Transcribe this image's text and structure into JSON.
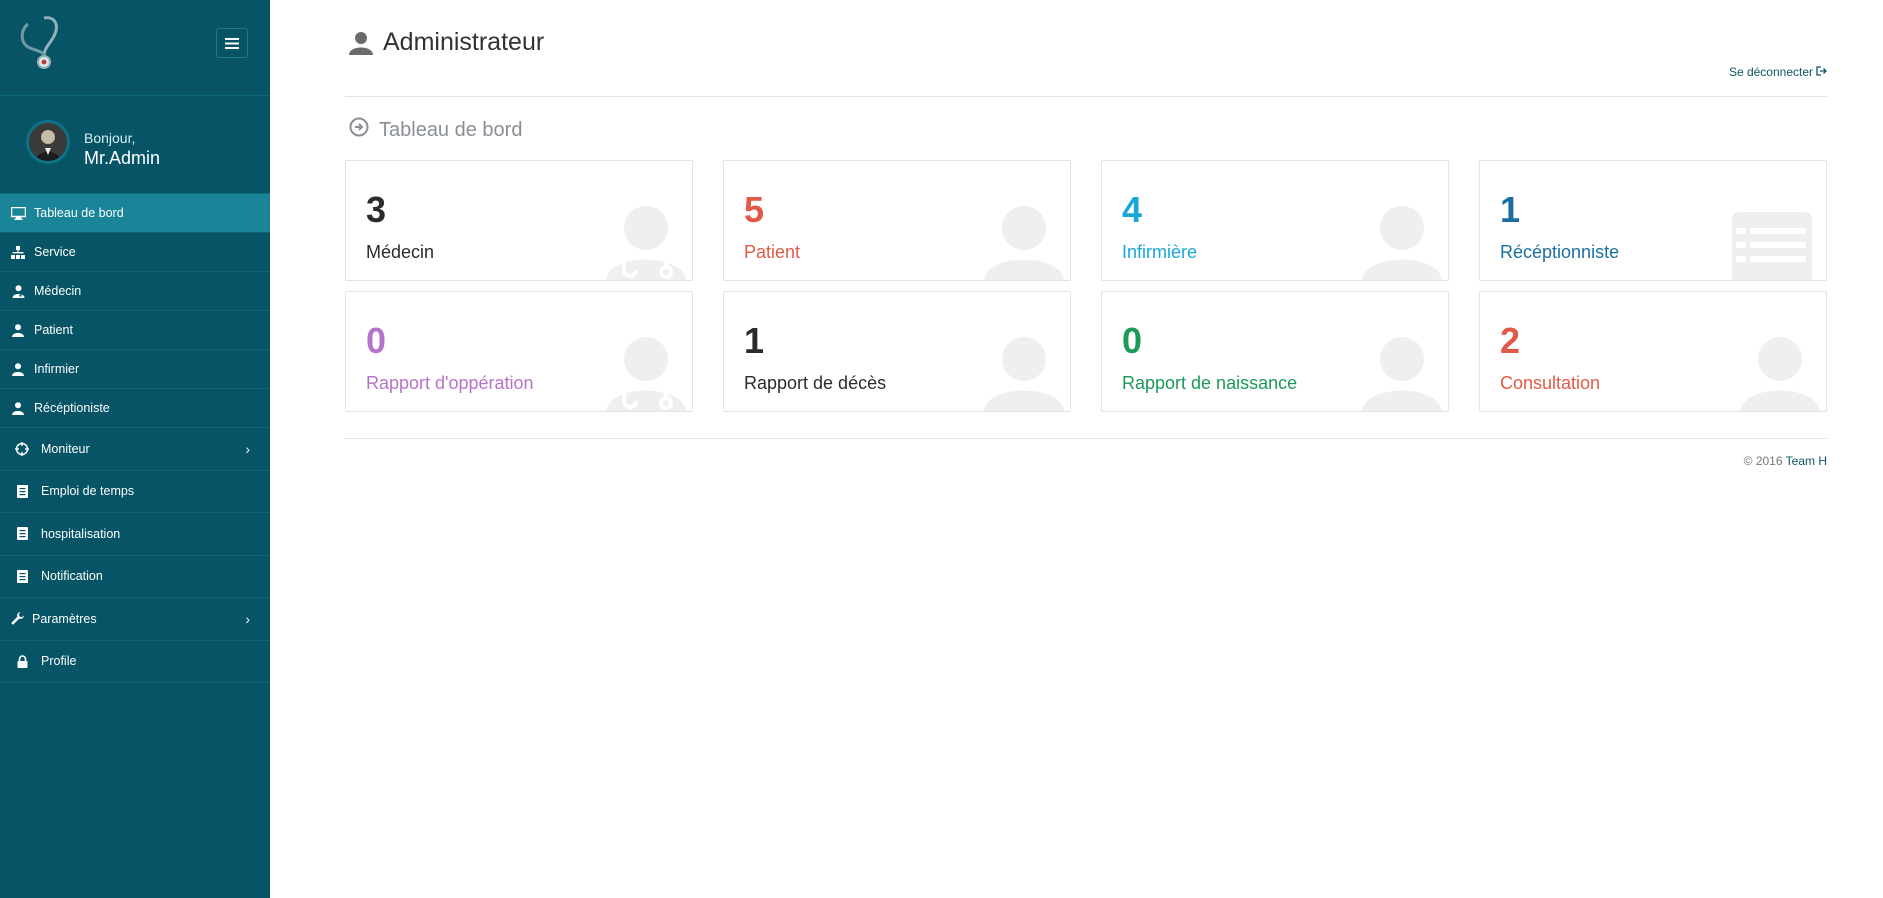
{
  "sidebar": {
    "greeting": "Bonjour,",
    "user_name": "Mr.Admin",
    "items": [
      {
        "label": "Tableau de bord",
        "icon": "monitor-icon",
        "active": true
      },
      {
        "label": "Service",
        "icon": "sitemap-icon"
      },
      {
        "label": "Médecin",
        "icon": "user-md-icon"
      },
      {
        "label": "Patient",
        "icon": "user-icon"
      },
      {
        "label": "Infirmier",
        "icon": "user-icon"
      },
      {
        "label": "Récéptioniste",
        "icon": "user-icon"
      },
      {
        "label": "Moniteur",
        "icon": "crosshair-icon",
        "has_submenu": true
      },
      {
        "label": "Emploi de temps",
        "icon": "document-icon"
      },
      {
        "label": "hospitalisation",
        "icon": "document-icon"
      },
      {
        "label": "Notification",
        "icon": "document-icon"
      },
      {
        "label": "Paramètres",
        "icon": "wrench-icon",
        "has_submenu": true
      },
      {
        "label": "Profile",
        "icon": "lock-icon"
      }
    ]
  },
  "header": {
    "title": "Administrateur",
    "logout_label": "Se déconnecter"
  },
  "main": {
    "section_title": "Tableau de bord",
    "cards": [
      {
        "value": "3",
        "label": "Médecin",
        "color": "#2b2b2b",
        "icon": "doctor-icon"
      },
      {
        "value": "5",
        "label": "Patient",
        "color": "#e05a47",
        "icon": "person-icon"
      },
      {
        "value": "4",
        "label": "Infirmière",
        "color": "#19a8d6",
        "icon": "person-icon"
      },
      {
        "value": "1",
        "label": "Récéptionniste",
        "color": "#1a6fa0",
        "icon": "list-icon"
      },
      {
        "value": "0",
        "label": "Rapport d'oppération",
        "color": "#b673c9",
        "icon": "doctor-icon"
      },
      {
        "value": "1",
        "label": "Rapport de décès",
        "color": "#2b2b2b",
        "icon": "person-icon"
      },
      {
        "value": "0",
        "label": "Rapport de naissance",
        "color": "#1b9a5a",
        "icon": "person-icon"
      },
      {
        "value": "2",
        "label": "Consultation",
        "color": "#e05a47",
        "icon": "person-icon"
      }
    ]
  },
  "footer": {
    "copyright": "© 2016",
    "team": "Team H"
  },
  "colors": {
    "sidebar_bg": "#065465",
    "sidebar_active": "#1a8499"
  }
}
